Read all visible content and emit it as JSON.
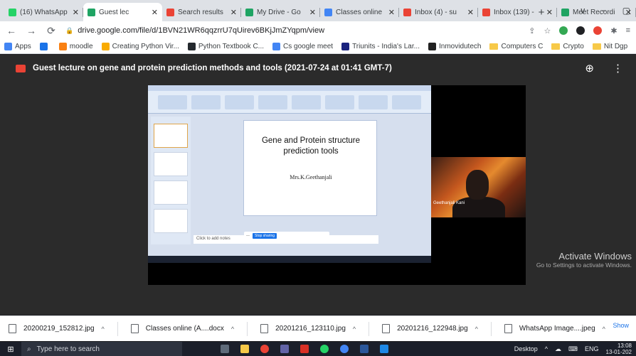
{
  "browser": {
    "tabs": [
      {
        "label": "(16) WhatsApp",
        "icon": "whatsapp-icon",
        "color": "#25d366",
        "active": false
      },
      {
        "label": "Guest lec",
        "icon": "drive-icon",
        "color": "#1fa463",
        "active": true
      },
      {
        "label": "Search results",
        "icon": "gmail-icon",
        "color": "#ea4335",
        "active": false
      },
      {
        "label": "My Drive - Go",
        "icon": "drive-icon",
        "color": "#1fa463",
        "active": false
      },
      {
        "label": "Classes online",
        "icon": "docs-icon",
        "color": "#4285f4",
        "active": false
      },
      {
        "label": "Inbox (4) - su",
        "icon": "gmail-icon",
        "color": "#ea4335",
        "active": false
      },
      {
        "label": "Inbox (139) -",
        "icon": "gmail-icon",
        "color": "#ea4335",
        "active": false
      },
      {
        "label": "Meet Recordi",
        "icon": "drive-icon",
        "color": "#1fa463",
        "active": false
      }
    ],
    "new_tab": "+",
    "window_controls": {
      "chevron": "∨",
      "minimize": "−",
      "restore": "▢"
    },
    "url": "drive.google.com/file/d/1BVN21WR6qqzrrU7qUirev6BKjJmZYqpm/view",
    "bookmarks": [
      {
        "label": "Apps",
        "icon": "apps-grid-icon",
        "color": "#4285f4"
      },
      {
        "label": "",
        "icon": "d-icon",
        "color": "#1a73e8"
      },
      {
        "label": "moodle",
        "icon": "moodle-icon",
        "color": "#f98012"
      },
      {
        "label": "Creating Python Vir...",
        "icon": "link-icon",
        "color": "#f9ab00"
      },
      {
        "label": "Python Textbook C...",
        "icon": "github-icon",
        "color": "#24292e"
      },
      {
        "label": "Cs google meet",
        "icon": "google-icon",
        "color": "#4285f4"
      },
      {
        "label": "Triunits - India's Lar...",
        "icon": "triunits-icon",
        "color": "#1a237e"
      },
      {
        "label": "Inmovidutech",
        "icon": "t-icon",
        "color": "#222"
      },
      {
        "label": "Computers C",
        "icon": "folder-icon",
        "color": "#f7c948"
      },
      {
        "label": "Crypto",
        "icon": "folder-icon",
        "color": "#f7c948"
      },
      {
        "label": "Nit Dgp",
        "icon": "folder-icon",
        "color": "#f7c948"
      }
    ],
    "more_bookmarks": "»",
    "reading_list": "Re"
  },
  "viewer": {
    "title": "Guest lecture on gene and protein prediction methods and tools (2021-07-24 at 01:41 GMT-7)",
    "add_shortcut_icon": "add-to-drive-icon",
    "menu_icon": "⋮"
  },
  "video": {
    "slide_title": "Gene and Protein structure prediction tools",
    "slide_author": "Mrs.K.Geethanjali",
    "notes_placeholder": "Click to add notes",
    "share_button": "Stop sharing",
    "participant_name": "Geethanjali Kani"
  },
  "watermark": {
    "line1": "Activate Windows",
    "line2": "Go to Settings to activate Windows."
  },
  "downloads": [
    {
      "name": "20200219_152812.jpg",
      "icon": "image-file-icon"
    },
    {
      "name": "Classes online (A....docx",
      "icon": "word-file-icon"
    },
    {
      "name": "20201216_123110.jpg",
      "icon": "image-file-icon"
    },
    {
      "name": "20201216_122948.jpg",
      "icon": "image-file-icon"
    },
    {
      "name": "WhatsApp Image....jpeg",
      "icon": "image-file-icon"
    }
  ],
  "downloads_show_all": "Show",
  "taskbar": {
    "search_placeholder": "Type here to search",
    "desktop_label": "Desktop",
    "language": "ENG",
    "time": "13:08",
    "date": "13-01-202"
  }
}
